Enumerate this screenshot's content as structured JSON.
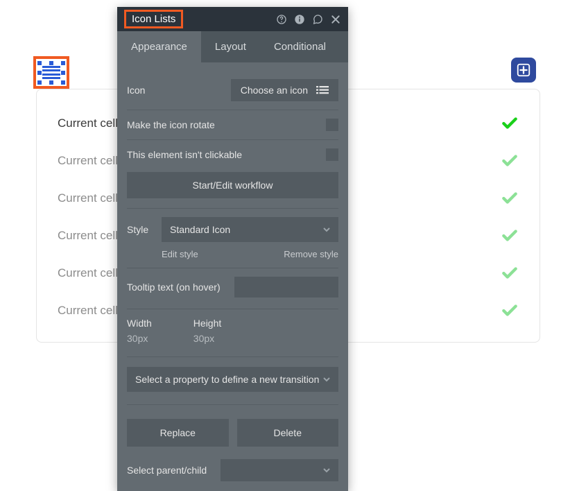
{
  "panel": {
    "title": "Icon Lists",
    "tabs": {
      "appearance": "Appearance",
      "layout": "Layout",
      "conditional": "Conditional"
    },
    "icon_label": "Icon",
    "choose_icon": "Choose an icon",
    "rotate_label": "Make the icon rotate",
    "clickable_label": "This element isn't clickable",
    "workflow_btn": "Start/Edit workflow",
    "style_label": "Style",
    "style_value": "Standard Icon",
    "edit_style": "Edit style",
    "remove_style": "Remove style",
    "tooltip_label": "Tooltip text (on hover)",
    "width_label": "Width",
    "width_value": "30px",
    "height_label": "Height",
    "height_value": "30px",
    "transition_placeholder": "Select a property to define a new transition",
    "replace": "Replace",
    "delete": "Delete",
    "parent_label": "Select parent/child"
  },
  "list": {
    "row1": "Current cell's Feature's description",
    "row2": "Current cell's Feature's description",
    "row3": "Current cell's Feature's description",
    "row4": "Current cell's Feature's description",
    "row5": "Current cell's Feature's description",
    "row6": "Current cell's Feature's description"
  }
}
